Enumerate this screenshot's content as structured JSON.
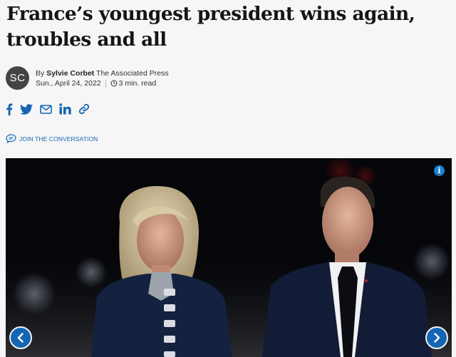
{
  "article": {
    "headline": "France’s youngest president wins again, troubles and all"
  },
  "author": {
    "initials": "SC",
    "by": "By",
    "name": "Sylvie Corbet",
    "org": "The Associated Press",
    "date": "Sun., April 24, 2022",
    "read_time": "3 min. read"
  },
  "share": {
    "icons": [
      "facebook-icon",
      "twitter-icon",
      "email-icon",
      "linkedin-icon",
      "link-icon"
    ]
  },
  "conversation": {
    "label": "JOIN THE CONVERSATION",
    "icon": "speech-bubble-icon"
  },
  "gallery": {
    "info_label": "i",
    "info_icon": "info-icon",
    "prev_icon": "chevron-left-icon",
    "next_icon": "chevron-right-icon"
  },
  "colors": {
    "accent": "#1565b4",
    "background": "#f6f6f6",
    "photo_background": "#05060a"
  }
}
